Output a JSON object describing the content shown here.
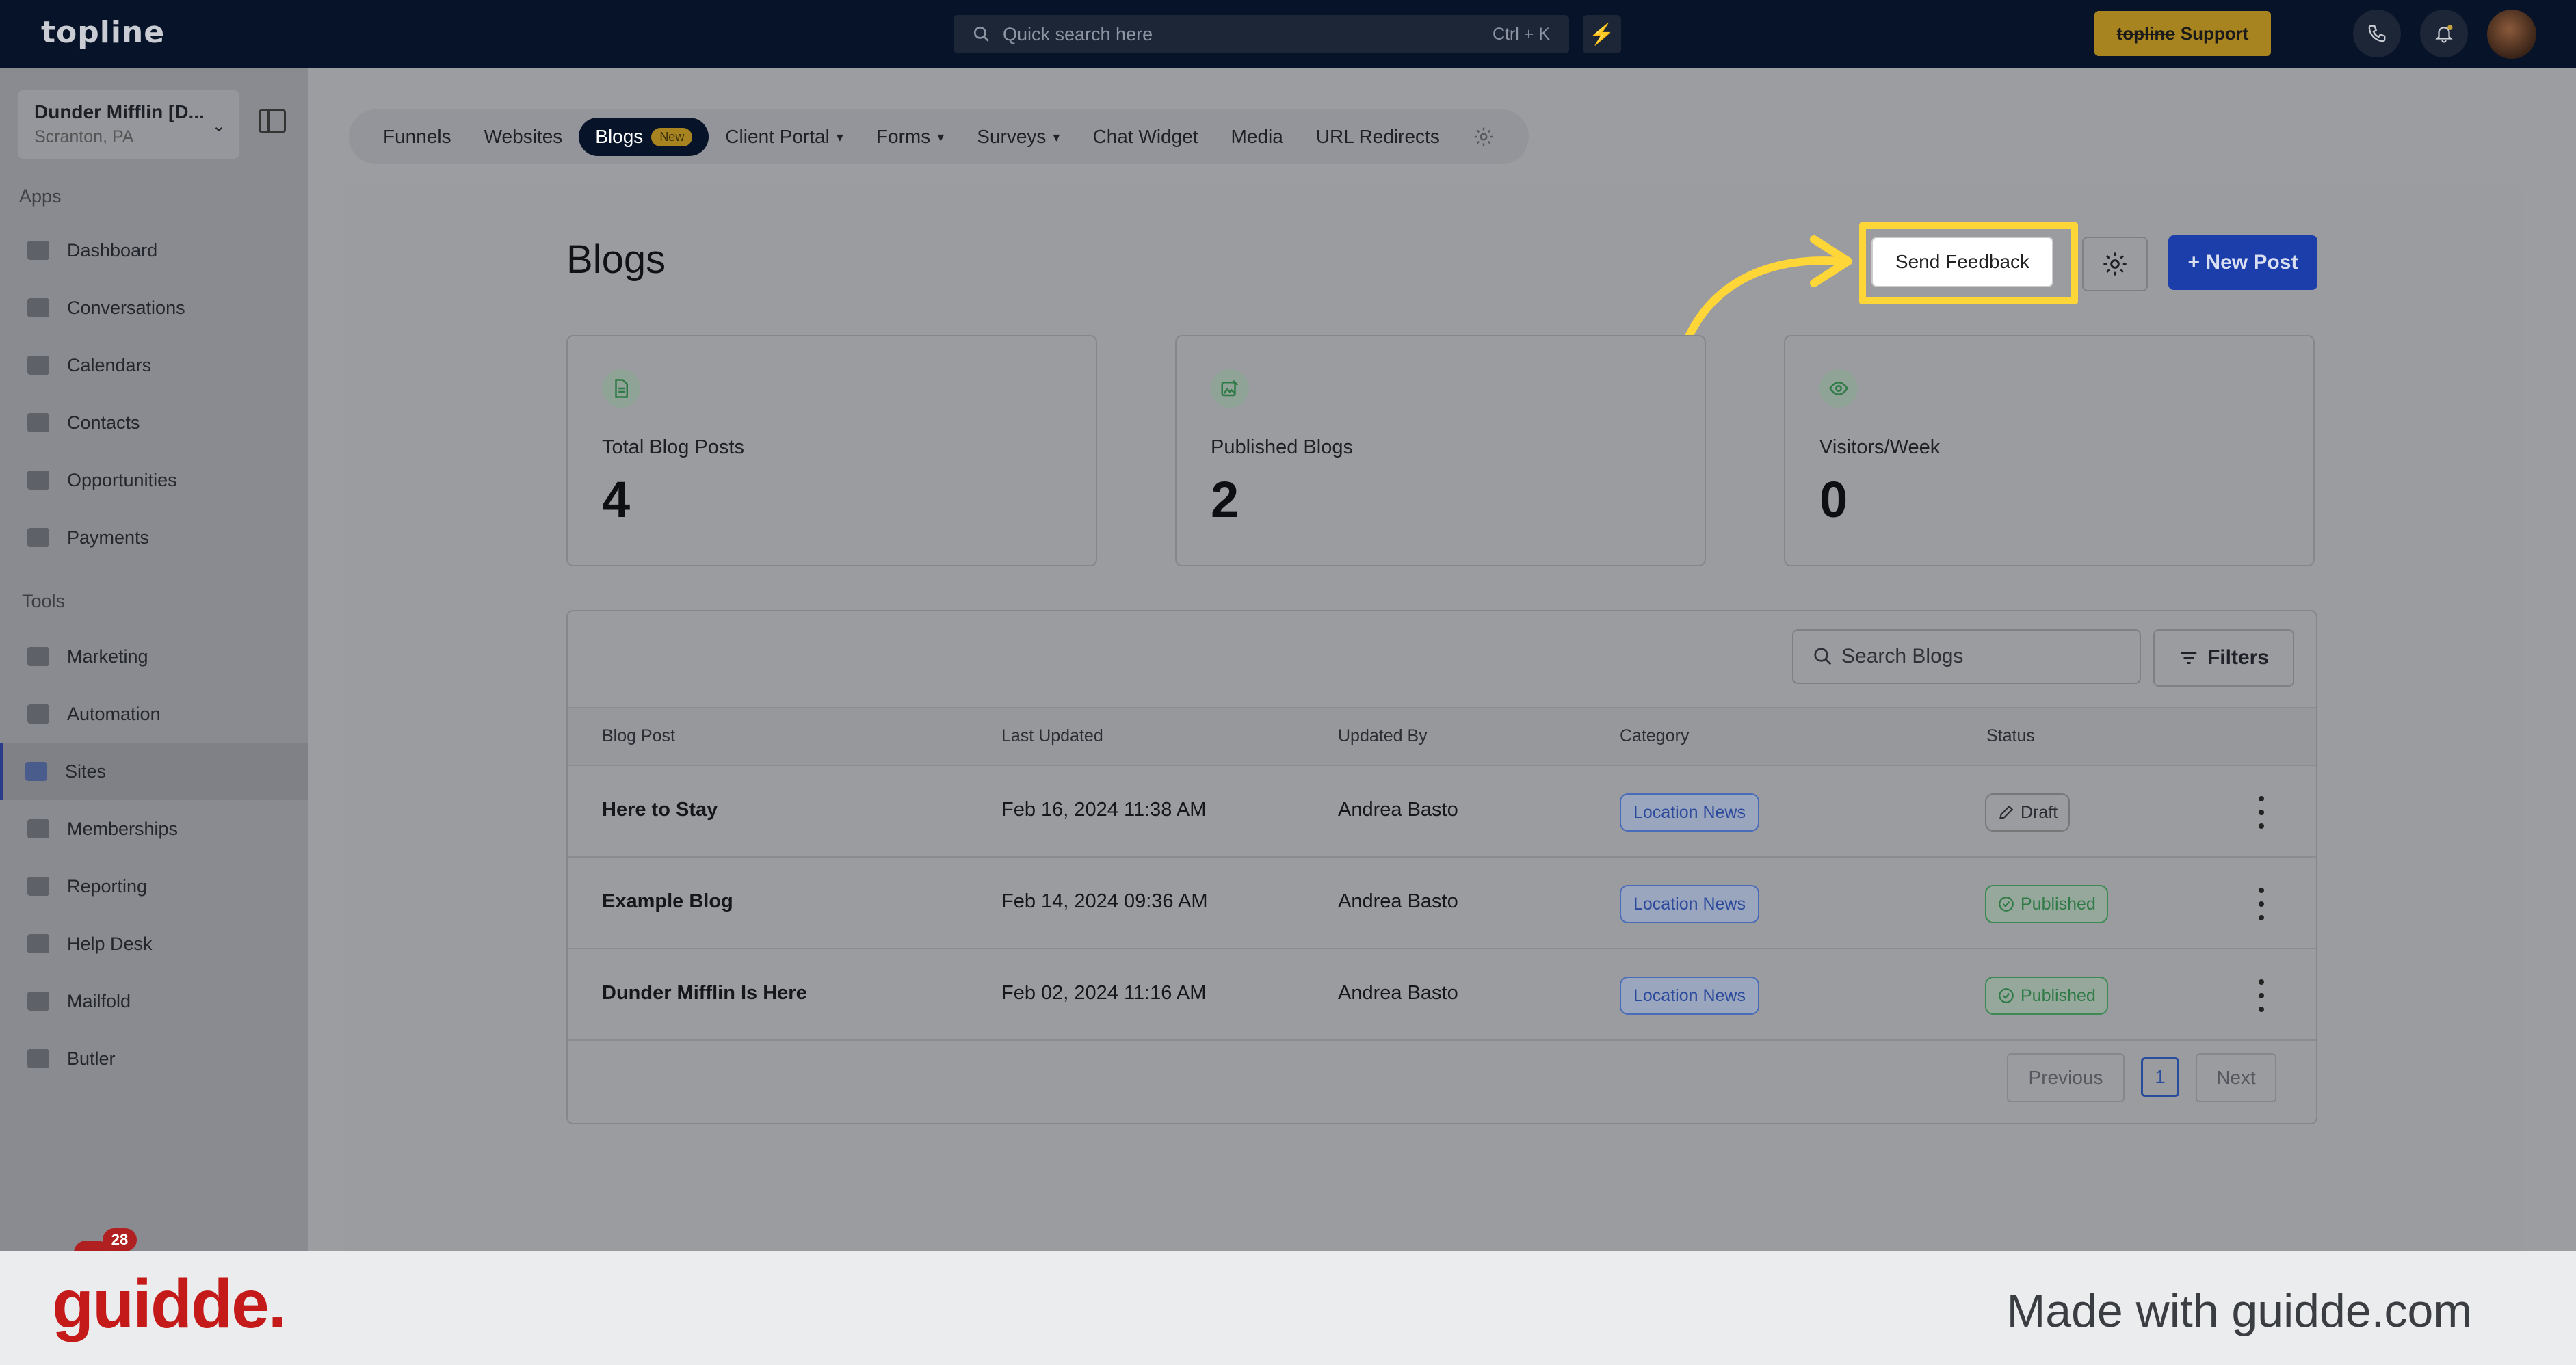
{
  "topbar": {
    "logo": "topline",
    "search_placeholder": "Quick search here",
    "search_shortcut": "Ctrl + K",
    "support_brand": "topline",
    "support_label": "Support"
  },
  "sidebar": {
    "account_name": "Dunder Mifflin [D...",
    "account_location": "Scranton, PA",
    "apps_heading": "Apps",
    "tools_heading": "Tools",
    "apps": [
      {
        "label": "Dashboard",
        "icon": "dashboard-icon"
      },
      {
        "label": "Conversations",
        "icon": "chat-icon"
      },
      {
        "label": "Calendars",
        "icon": "calendar-icon"
      },
      {
        "label": "Contacts",
        "icon": "person-icon"
      },
      {
        "label": "Opportunities",
        "icon": "target-icon"
      },
      {
        "label": "Payments",
        "icon": "card-icon"
      }
    ],
    "tools": [
      {
        "label": "Marketing",
        "icon": "megaphone-icon"
      },
      {
        "label": "Automation",
        "icon": "gears-icon"
      },
      {
        "label": "Sites",
        "icon": "globe-icon",
        "active": true
      },
      {
        "label": "Memberships",
        "icon": "people-icon"
      },
      {
        "label": "Reporting",
        "icon": "pie-icon"
      },
      {
        "label": "Help Desk",
        "icon": "help-icon"
      },
      {
        "label": "Mailfold",
        "icon": "mail-icon"
      },
      {
        "label": "Butler",
        "icon": "bell-stand-icon"
      }
    ],
    "notification_count": "28"
  },
  "tabs": [
    {
      "label": "Funnels"
    },
    {
      "label": "Websites"
    },
    {
      "label": "Blogs",
      "badge": "New",
      "active": true
    },
    {
      "label": "Client Portal",
      "dropdown": true
    },
    {
      "label": "Forms",
      "dropdown": true
    },
    {
      "label": "Surveys",
      "dropdown": true
    },
    {
      "label": "Chat Widget"
    },
    {
      "label": "Media"
    },
    {
      "label": "URL Redirects"
    }
  ],
  "page": {
    "title": "Blogs",
    "send_feedback": "Send Feedback",
    "new_post": "+ New Post"
  },
  "stats": [
    {
      "label": "Total Blog Posts",
      "value": "4",
      "icon": "document-icon"
    },
    {
      "label": "Published Blogs",
      "value": "2",
      "icon": "image-edit-icon"
    },
    {
      "label": "Visitors/Week",
      "value": "0",
      "icon": "eye-icon"
    }
  ],
  "table": {
    "search_placeholder": "Search Blogs",
    "filters_label": "Filters",
    "columns": [
      "Blog Post",
      "Last Updated",
      "Updated By",
      "Category",
      "Status"
    ],
    "rows": [
      {
        "post": "Here to Stay",
        "updated": "Feb 16, 2024 11:38 AM",
        "by": "Andrea Basto",
        "category": "Location News",
        "status": "Draft"
      },
      {
        "post": "Example Blog",
        "updated": "Feb 14, 2024 09:36 AM",
        "by": "Andrea Basto",
        "category": "Location News",
        "status": "Published"
      },
      {
        "post": "Dunder Mifflin Is Here",
        "updated": "Feb 02, 2024 11:16 AM",
        "by": "Andrea Basto",
        "category": "Location News",
        "status": "Published"
      }
    ],
    "pagination": {
      "previous": "Previous",
      "page": "1",
      "next": "Next"
    }
  },
  "footer": {
    "brand": "guidde.",
    "made_with": "Made with guidde.com"
  },
  "colors": {
    "topbar": "#071328",
    "accent_blue": "#1c3eaa",
    "highlight_yellow": "#ffd637",
    "guidde_red": "#c41a1a"
  }
}
